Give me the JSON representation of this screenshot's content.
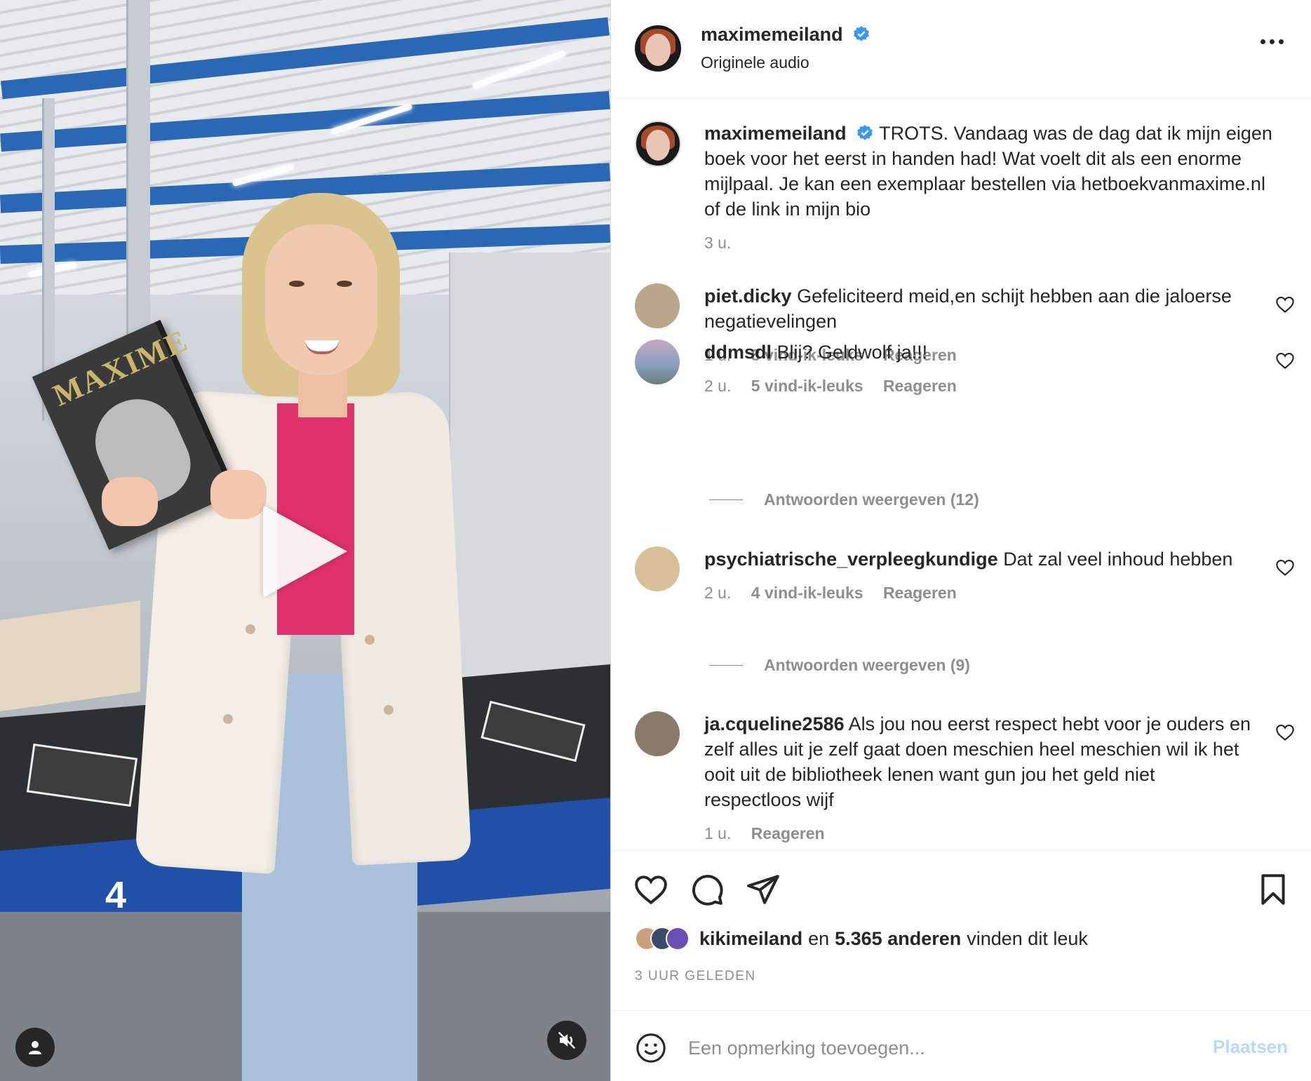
{
  "media": {
    "book_title": "MAXIME",
    "lane_number": "4",
    "icons": {
      "play": "play-icon",
      "user": "user-icon",
      "mute": "speaker-muted-icon"
    }
  },
  "header": {
    "username": "maximemeiland",
    "subtitle": "Originele audio",
    "verified_icon": "verified-badge-icon",
    "more_icon": "more-options-icon"
  },
  "caption": {
    "username": "maximemeiland",
    "text": "TROTS. Vandaag was de dag dat ik mijn eigen boek voor het eerst in handen had! Wat voelt dit als een enorme mijlpaal. Je kan een exemplaar bestellen via hetboekvanmaxime.nl of de link in mijn bio",
    "time": "3 u."
  },
  "comments": [
    {
      "username": "piet.dicky",
      "text": "Gefeliciteerd meid,en schijt hebben aan die jaloerse negatievelingen",
      "time": "1 u.",
      "likes": "8 vind-ik-leuks",
      "reply": "Reageren",
      "replies": ""
    },
    {
      "username": "ddmsdl",
      "text": "Blij? Geldwolf ja!!!",
      "time": "2 u.",
      "likes": "5 vind-ik-leuks",
      "reply": "Reageren",
      "replies": "Antwoorden weergeven (12)"
    },
    {
      "username": "psychiatrische_verpleegkundige",
      "text": "Dat zal veel inhoud hebben",
      "time": "2 u.",
      "likes": "4 vind-ik-leuks",
      "reply": "Reageren",
      "replies": "Antwoorden weergeven (9)"
    },
    {
      "username": "ja.cqueline2586",
      "text": "Als jou nou eerst respect hebt voor je ouders en zelf alles uit je zelf gaat doen meschien heel meschien wil ik het ooit uit de bibliotheek lenen want gun jou het geld niet respectloos wijf",
      "time": "1 u.",
      "likes": "",
      "reply": "Reageren",
      "replies": ""
    }
  ],
  "actions": {
    "icons": [
      "heart-icon",
      "comment-icon",
      "share-icon",
      "bookmark-icon"
    ],
    "liked_by_user": "kikimeiland",
    "liked_by_connector": "en",
    "liked_by_count": "5.365 anderen",
    "liked_by_suffix": "vinden dit leuk",
    "posted": "3 UUR GELEDEN"
  },
  "composer": {
    "placeholder": "Een opmerking toevoegen...",
    "post_label": "Plaatsen",
    "emoji_icon": "emoji-icon"
  },
  "colors": {
    "link_disabled": "#b3dbff",
    "verified": "#3897f0",
    "secondary_text": "#8e8e8e",
    "primary_text": "#262626"
  }
}
